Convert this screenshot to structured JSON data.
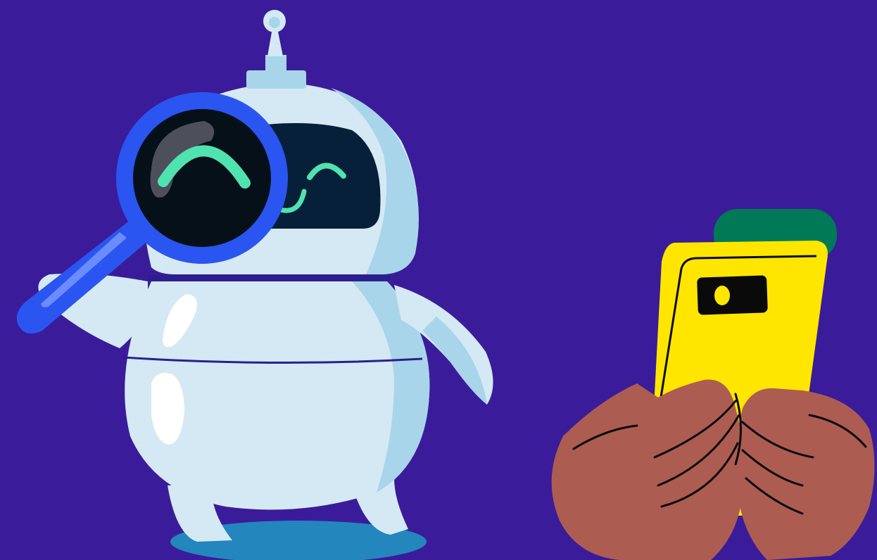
{
  "colors": {
    "background": "#3a1c9a",
    "robot_body": "#d5e9f4",
    "robot_shade": "#a9d5ea",
    "robot_outline_accent": "#2a1f8c",
    "visor": "#07203a",
    "smile": "#4fe3b0",
    "magnifier_ring": "#2a55f0",
    "magnifier_lens": "#061018",
    "shadow": "#2386bd",
    "phone": "#ffe600",
    "phone_back": "#007a56",
    "camera": "#0a0a0a",
    "camera_dot": "#ffe600",
    "hand_skin": "#ad5c52"
  },
  "scene": {
    "robot": {
      "name_hint": "robot-with-magnifier",
      "holding": "magnifying-glass",
      "expression": "smiling"
    },
    "phone": {
      "held_by": "two-hands",
      "color_name": "yellow"
    }
  }
}
